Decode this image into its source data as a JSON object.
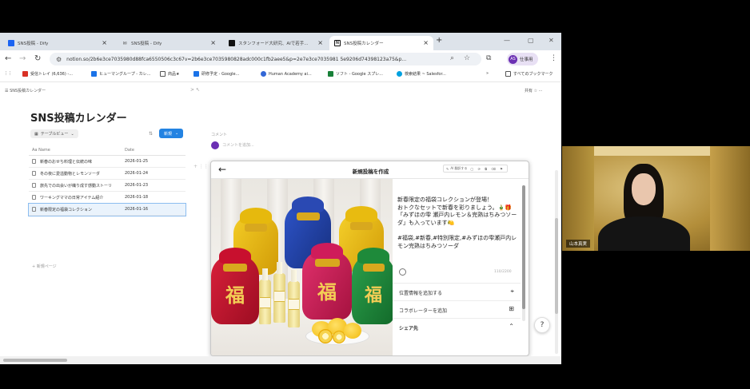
{
  "browser": {
    "tabs": [
      {
        "title": "SNS投稿 - Dify",
        "icon_color": "#1c64f2"
      },
      {
        "title": "SNS投稿 - Dify",
        "icon_color": "#555555"
      },
      {
        "title": "スタンフォード大研究、AIで若手...",
        "icon_color": "#111111"
      },
      {
        "title": "SNS投稿カレンダー",
        "icon_color": "#111111"
      }
    ],
    "url": "notion.so/2b6e3ce7035980d88fca6550506c3c67v=2b6e3ce7035980828adc000c1fb2aee5&p=2e7e3ce7035981 5e9206d74398123a75&p...",
    "profile_label": "仕事用",
    "profile_initials": "AS"
  },
  "bookmarks": [
    {
      "label": "受信トレイ (6,636) -...",
      "color": "#d93025"
    },
    {
      "label": "ヒューマングループ - カレ...",
      "color": "#1a73e8"
    },
    {
      "label": "商品★",
      "color": "#555555"
    },
    {
      "label": "研修予定 - Google...",
      "color": "#1a73e8"
    },
    {
      "label": "Human Academy ai...",
      "color": "#3367d6"
    },
    {
      "label": "ソフト - Google スプレ...",
      "color": "#188038"
    },
    {
      "label": "検索結果 ~ Salesfor...",
      "color": "#00a1e0"
    },
    {
      "label": "すべてのブックマーク",
      "color": "#555555"
    }
  ],
  "notion": {
    "breadcrumb": "SNS投稿カレンダー",
    "top_right": "共有",
    "title": "SNS投稿カレンダー",
    "view_label": "テーブルビュー",
    "new_label": "新規",
    "columns": {
      "name": "Aa Name",
      "date": "Date"
    },
    "rows": [
      {
        "name": "新春のおせち料理と伝統の味",
        "date": "2026-01-25"
      },
      {
        "name": "冬の夜に愛溢動物とレモンソーダ",
        "date": "2026-01-24"
      },
      {
        "name": "旅先での出会いが織り成す感動ストーリ",
        "date": "2026-01-23"
      },
      {
        "name": "ワーキングママの日常アイテム紹介",
        "date": "2026-01-18"
      },
      {
        "name": "新春限定の福袋コレクション",
        "date": "2026-01-16"
      }
    ],
    "add_page": "+ 新規ページ",
    "comment_label": "コメント",
    "comment_placeholder": "コメントを追加..."
  },
  "dialog": {
    "title": "新規投稿を作成",
    "toolbar": "AI 翻訳する",
    "caption": "新春限定の福袋コレクションが登場！\nおトクなセットで新春を彩りましょう。🎍🎁\n「みずほの雫 瀬戸内レモン＆完熟はちみつソーダ」も入っています🍋\n\n#福袋,#新春,#特別限定,#みずほの雫瀬戸内レモン完熟はちみつソーダ",
    "char_count": "110/2200",
    "location": "位置情報を追加する",
    "collaborator": "コラボレーターを追加",
    "share": "シェア先"
  },
  "image": {
    "bag_kanji": "福",
    "bag_colors": [
      "#c8102e",
      "#e5b80b",
      "#1f3fa8",
      "#cf1c5a",
      "#e9b70c",
      "#1e8a3a"
    ]
  },
  "webcam": {
    "name": "山本真実"
  }
}
